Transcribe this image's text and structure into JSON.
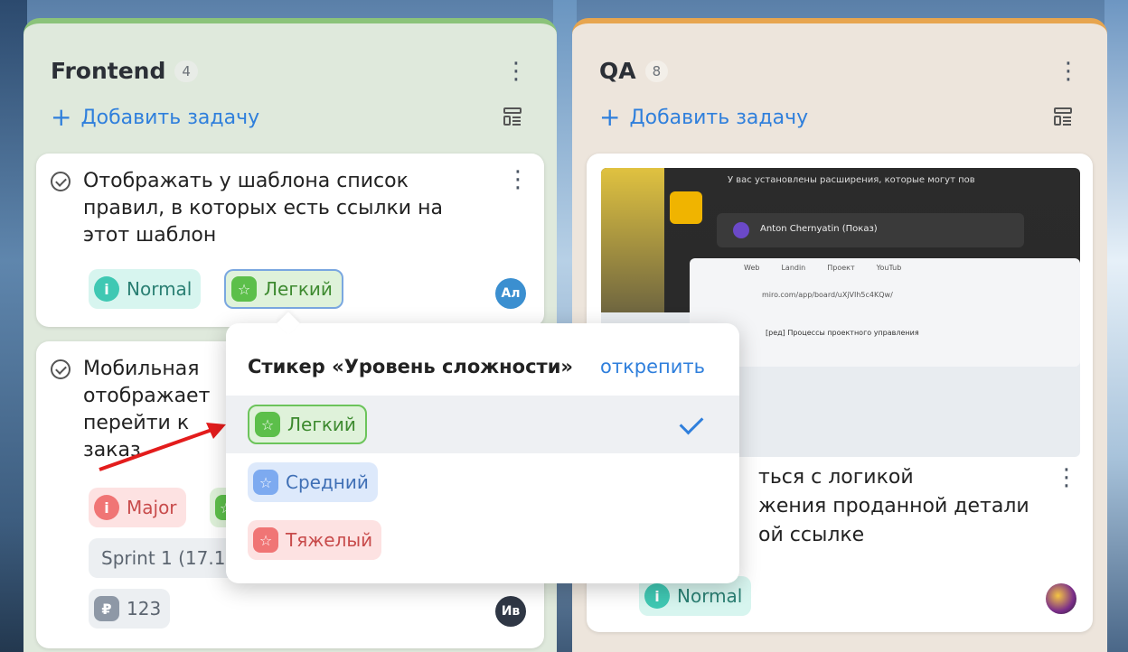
{
  "columns": [
    {
      "title": "Frontend",
      "count": "4",
      "add_label": "Добавить задачу"
    },
    {
      "title": "QA",
      "count": "8",
      "add_label": "Добавить задачу"
    }
  ],
  "frontend_cards": [
    {
      "title": "Отображать у шаблона список правил, в которых есть ссылки на этот шаблон",
      "priority": "Normal",
      "difficulty": "Легкий",
      "avatar": "Ал"
    },
    {
      "title_visible": "Мобильная",
      "title_line2": "отображает",
      "title_line3": "перейти к",
      "title_line4": "заказ",
      "priority": "Major",
      "sprint": "Sprint 1 (17.1",
      "money": "123",
      "avatar": "Ив"
    }
  ],
  "qa_card": {
    "screenshot": {
      "line1": "У вас установлены расширения, которые могут пов",
      "user": "Anton Chernyatin (Показ)",
      "tabs": [
        "Web",
        "Landin",
        "Проект",
        "YouTub"
      ],
      "address": "miro.com/app/board/uXjVIh5c4KQw/",
      "board": "[ред] Процессы проектного управления"
    },
    "title_line1": "ться с логикой",
    "title_line2": "жения проданной детали",
    "title_line3": "ой ссылке",
    "priority": "Normal"
  },
  "popover": {
    "title": "Стикер «Уровень сложности»",
    "unpin": "открепить",
    "options": [
      "Легкий",
      "Средний",
      "Тяжелый"
    ],
    "selected": "Легкий"
  },
  "colors": {
    "frontend_accent": "#8bc37a",
    "qa_accent": "#e7a54f",
    "link": "#2f7fdc"
  }
}
